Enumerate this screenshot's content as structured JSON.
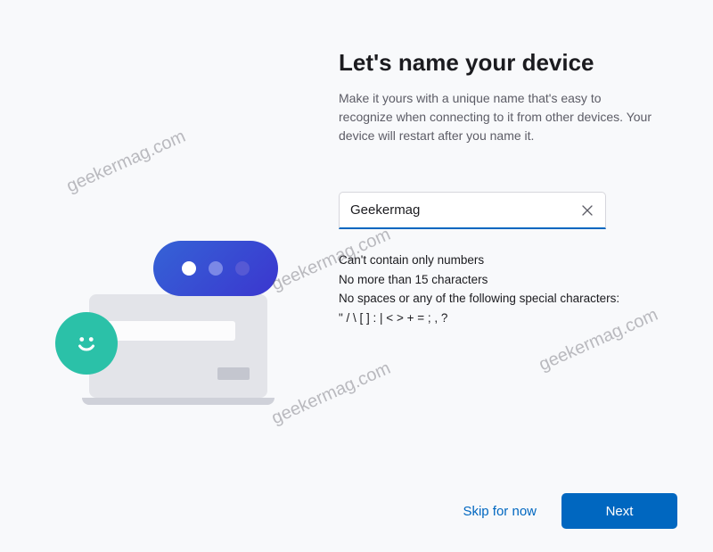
{
  "heading": "Let's name your device",
  "description": "Make it yours with a unique name that's easy to recognize when connecting to it from other devices. Your device will restart after you name it.",
  "input": {
    "value": "Geekermag"
  },
  "rules": {
    "line1": "Can't contain only numbers",
    "line2": "No more than 15 characters",
    "line3": "No spaces or any of the following special characters:",
    "line4": "\" / \\ [ ] : | < > + = ; , ?"
  },
  "buttons": {
    "skip": "Skip for now",
    "next": "Next"
  },
  "watermark": "geekermag.com"
}
